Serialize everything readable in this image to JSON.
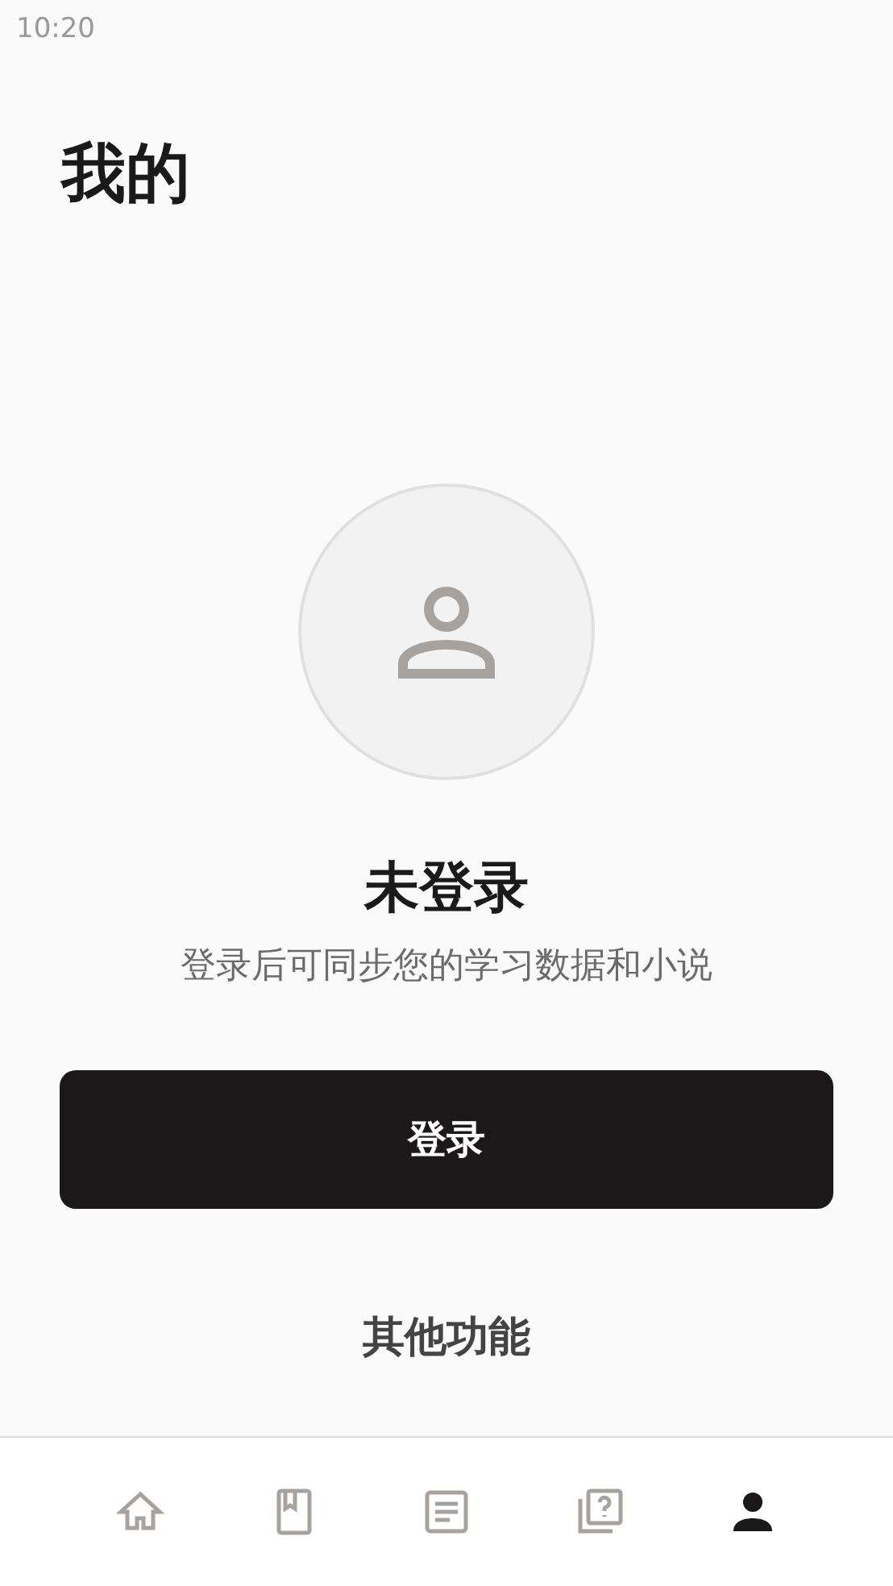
{
  "status_bar": {
    "time": "10:20"
  },
  "page_title": "我的",
  "profile": {
    "name": "未登录",
    "hint": "登录后可同步您的学习数据和小说"
  },
  "login_button": "登录",
  "section_title": "其他功能",
  "nav": [
    {
      "kind": "home",
      "selected": false
    },
    {
      "kind": "book",
      "selected": false
    },
    {
      "kind": "article",
      "selected": false
    },
    {
      "kind": "quiz",
      "selected": false
    },
    {
      "kind": "person",
      "selected": true
    }
  ]
}
